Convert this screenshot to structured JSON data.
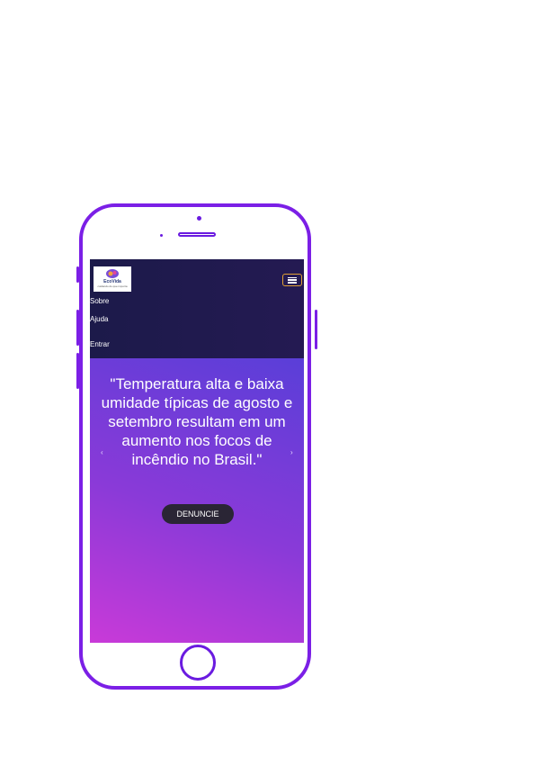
{
  "navbar": {
    "logo": {
      "brand": "EcoVida",
      "tagline": "cuidando do que importa"
    },
    "menu_icon": "menu-icon",
    "links": [
      "Sobre",
      "Ajuda",
      "Entrar"
    ]
  },
  "hero": {
    "quote": "\"Temperatura alta e baixa umidade típicas de agosto e setembro resultam em um aumento nos focos de incêndio no Brasil.\"",
    "prev_glyph": "‹",
    "next_glyph": "›",
    "cta_label": "DENUNCIE"
  },
  "colors": {
    "phone_frame": "#7b1fe6",
    "navbar_bg": "#1c1a4a",
    "toggler_border": "#e0a035",
    "hero_gradient_start": "#c93ad8",
    "hero_gradient_end": "#5a3ed8",
    "cta_bg": "#2a2535"
  }
}
